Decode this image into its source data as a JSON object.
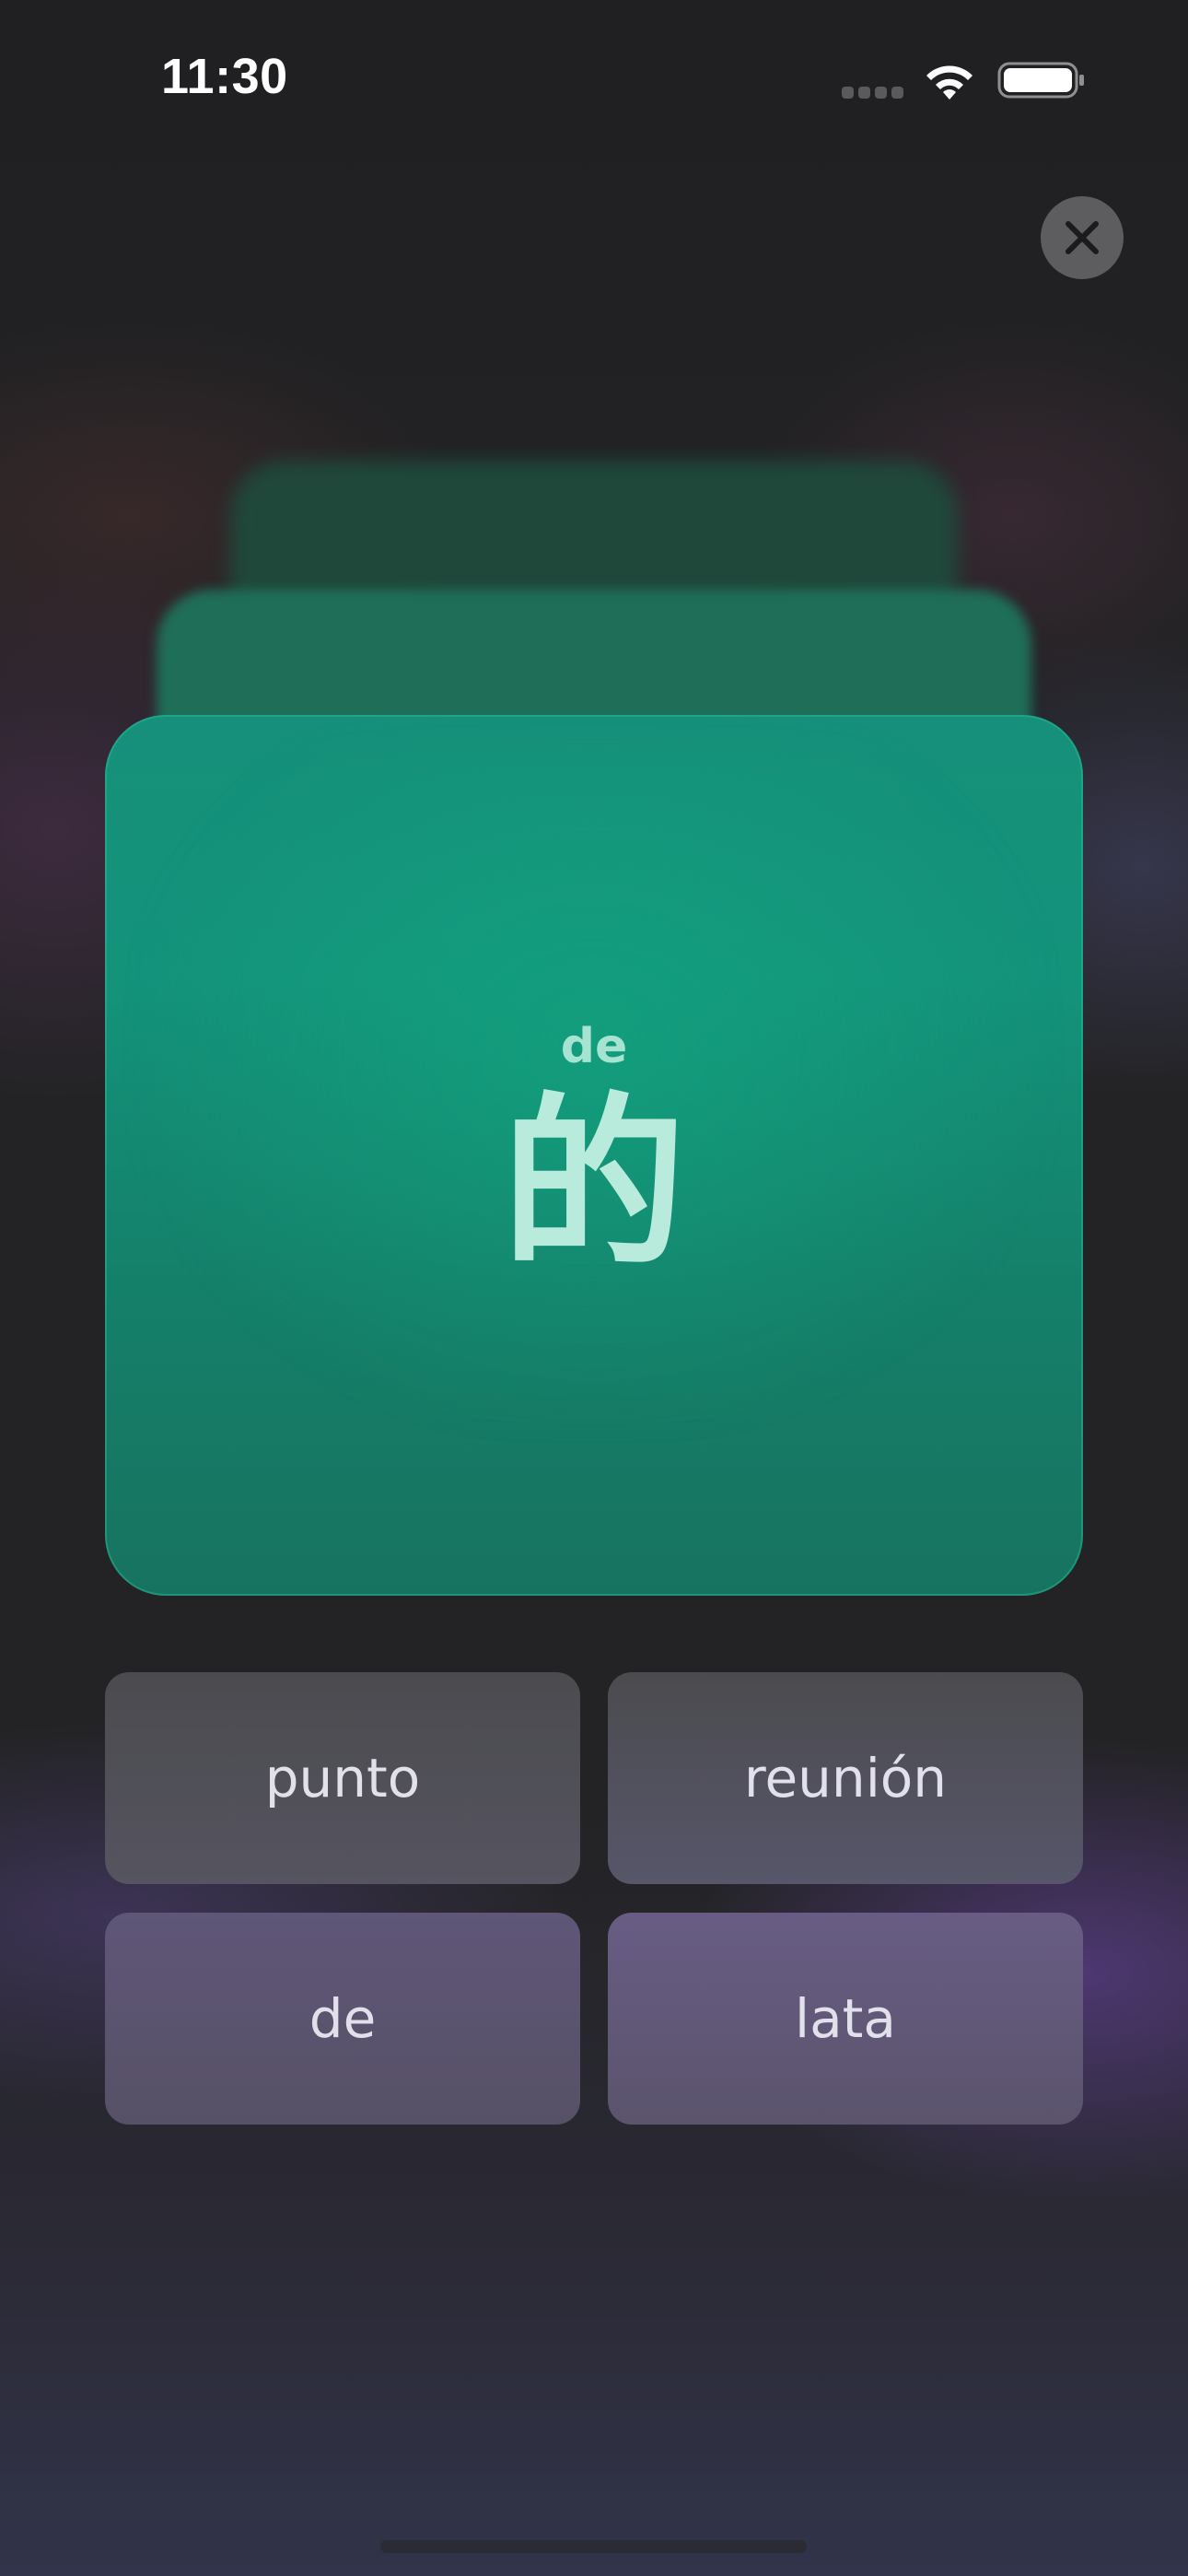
{
  "status_bar": {
    "time": "11:30",
    "signal_icon": "cellular-signal-icon",
    "wifi_icon": "wifi-icon",
    "battery_icon": "battery-full-icon",
    "battery_level": 1.0
  },
  "close_button": {
    "icon": "close-icon"
  },
  "flashcard": {
    "pinyin": "de",
    "character": "的",
    "color": "#14937b"
  },
  "options": [
    {
      "label": "punto"
    },
    {
      "label": "reunión"
    },
    {
      "label": "de"
    },
    {
      "label": "lata"
    }
  ]
}
